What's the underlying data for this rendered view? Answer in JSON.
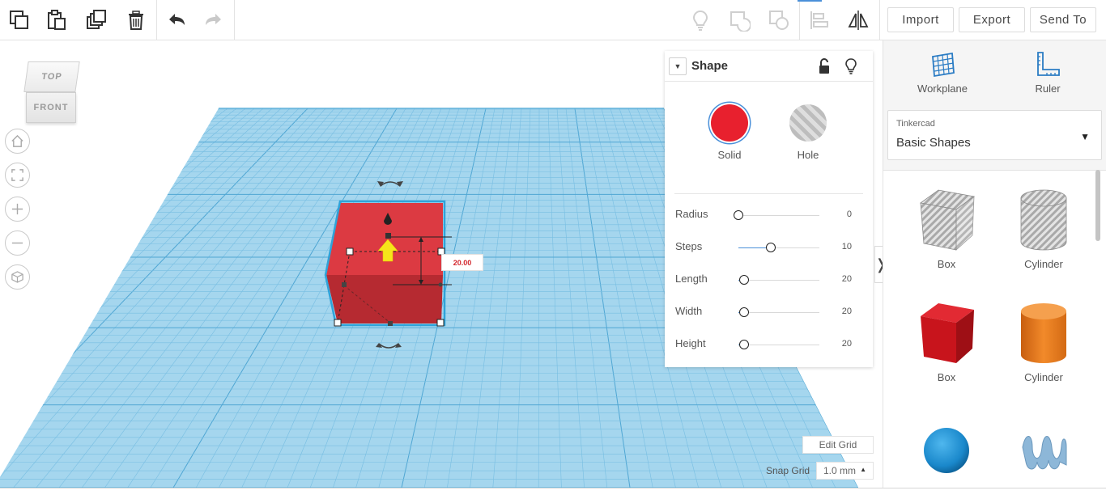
{
  "toolbar": {
    "icons": [
      "copy-icon",
      "paste-icon",
      "duplicate-icon",
      "delete-icon",
      "undo-icon",
      "redo-icon",
      "note-bulb-icon",
      "group-icon",
      "ungroup-icon",
      "align-icon",
      "mirror-icon"
    ],
    "import_label": "Import",
    "export_label": "Export",
    "send_to_label": "Send To"
  },
  "viewcube": {
    "top_label": "TOP",
    "front_label": "FRONT"
  },
  "shape_panel": {
    "title": "Shape",
    "solid_label": "Solid",
    "hole_label": "Hole",
    "solid_color": "#e8202e",
    "params": [
      {
        "label": "Radius",
        "value": "0",
        "fraction": 0.0
      },
      {
        "label": "Steps",
        "value": "10",
        "fraction": 0.4
      },
      {
        "label": "Length",
        "value": "20",
        "fraction": 0.07
      },
      {
        "label": "Width",
        "value": "20",
        "fraction": 0.07
      },
      {
        "label": "Height",
        "value": "20",
        "fraction": 0.07
      }
    ]
  },
  "dimension_label": "20.00",
  "right_panel": {
    "workplane_label": "Workplane",
    "ruler_label": "Ruler",
    "library_source": "Tinkercad",
    "library_name": "Basic Shapes",
    "items": [
      {
        "label": "Box",
        "kind": "hole-box"
      },
      {
        "label": "Cylinder",
        "kind": "hole-cylinder"
      },
      {
        "label": "Box",
        "kind": "box",
        "color": "#d0131b"
      },
      {
        "label": "Cylinder",
        "kind": "cylinder",
        "color": "#f07d1c"
      },
      {
        "label": "",
        "kind": "sphere",
        "color": "#1c8ccf"
      },
      {
        "label": "",
        "kind": "scribble",
        "color": "#8ab4d6"
      }
    ]
  },
  "grid_controls": {
    "edit_grid_label": "Edit Grid",
    "snap_grid_label": "Snap Grid",
    "snap_value": "1.0 mm"
  },
  "colors": {
    "workplane": "#a5d6ee",
    "grid_line": "#72bbe0",
    "accent": "#4a90d9",
    "box_red": "#d8343b"
  }
}
